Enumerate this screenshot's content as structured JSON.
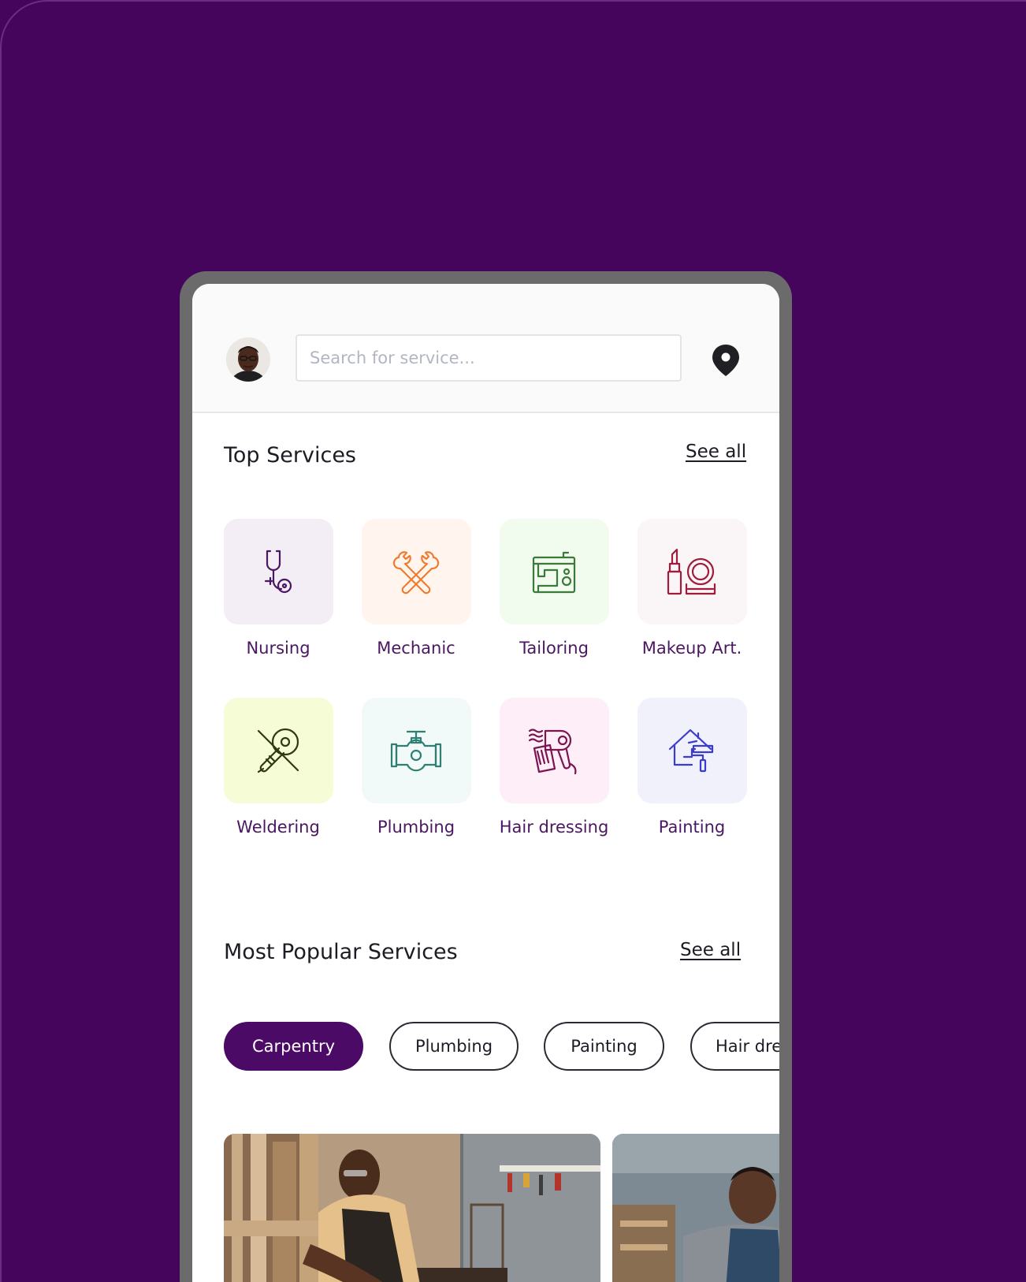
{
  "search": {
    "placeholder": "Search for service..."
  },
  "top_services": {
    "title": "Top Services",
    "see_all": "See all",
    "items": [
      {
        "label": "Nursing",
        "icon": "stethoscope-icon",
        "tile_color": "#f3eef5",
        "icon_color": "#4a1760"
      },
      {
        "label": "Mechanic",
        "icon": "wrenches-icon",
        "tile_color": "#fff5ee",
        "icon_color": "#f07b2e"
      },
      {
        "label": "Tailoring",
        "icon": "sewing-machine-icon",
        "tile_color": "#f1fbee",
        "icon_color": "#3c7a3a"
      },
      {
        "label": "Makeup Art.",
        "icon": "lipstick-compact-icon",
        "tile_color": "#faf6f7",
        "icon_color": "#a01c3c"
      },
      {
        "label": "Weldering",
        "icon": "angle-grinder-icon",
        "tile_color": "#f5fcd6",
        "icon_color": "#2e3a10"
      },
      {
        "label": "Plumbing",
        "icon": "pipe-valve-icon",
        "tile_color": "#f1faf8",
        "icon_color": "#2f7f74"
      },
      {
        "label": "Hair dressing",
        "icon": "hair-dryer-comb-icon",
        "tile_color": "#fdeef8",
        "icon_color": "#7a1550"
      },
      {
        "label": "Painting",
        "icon": "house-paint-roller-icon",
        "tile_color": "#f1f1fc",
        "icon_color": "#3a3ccf"
      }
    ]
  },
  "popular_services": {
    "title": "Most Popular Services",
    "see_all": "See all",
    "chips": [
      {
        "label": "Carpentry",
        "active": true
      },
      {
        "label": "Plumbing",
        "active": false
      },
      {
        "label": "Painting",
        "active": false
      },
      {
        "label": "Hair dressing",
        "active": false
      }
    ]
  },
  "colors": {
    "brand_purple": "#45055c",
    "chip_active": "#4b0a66",
    "label_purple": "#4a1760"
  }
}
